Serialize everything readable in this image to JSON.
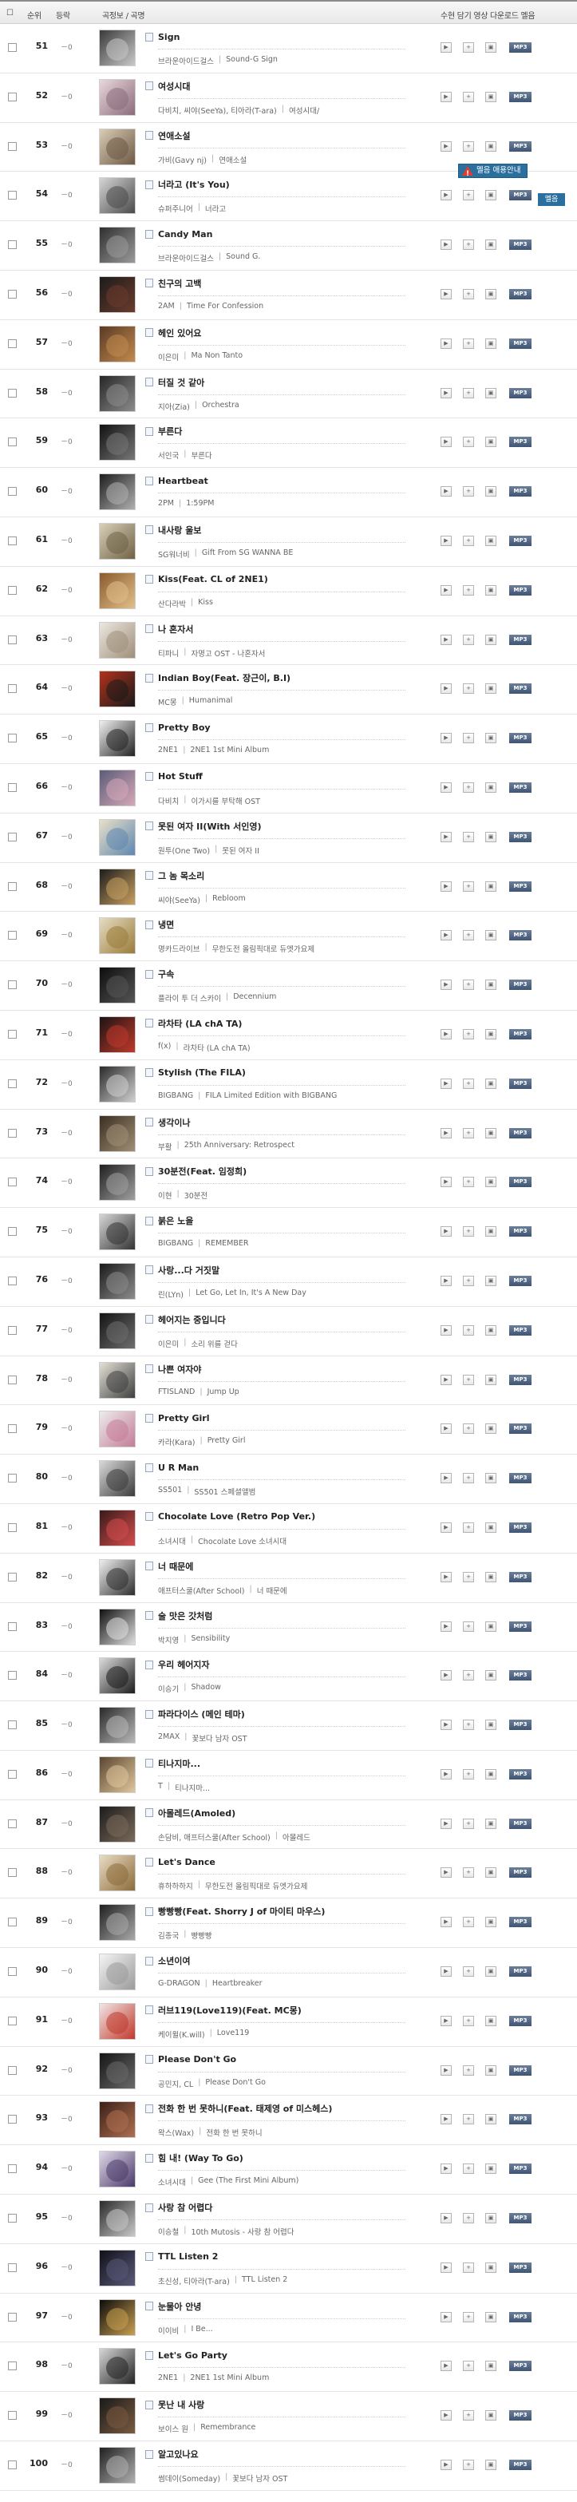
{
  "header": {
    "col_rank": "순위",
    "col_change": "등락",
    "col_song": "곡정보 / 곡명",
    "col_actions": "수현 담기 영상 다운로드 멜음"
  },
  "labels": {
    "change": "－0",
    "mp3": "MP3",
    "tooltip_main": "멜음 애용안내",
    "tooltip_side": "멜음"
  },
  "rows": [
    {
      "rank": "51",
      "title": "Sign",
      "artist": "브라운아이드걸스",
      "album": "Sound-G Sign",
      "c1": "#3a3a3a",
      "c2": "#c9c9c9"
    },
    {
      "rank": "52",
      "title": "여성시대",
      "artist": "다비치, 씨야(SeeYa), 티아라(T-ara)",
      "album": "여성시대/",
      "c1": "#e9d7dc",
      "c2": "#8b6b7b"
    },
    {
      "rank": "53",
      "title": "연애소설",
      "artist": "가비(Gavy nj)",
      "album": "연애소설",
      "c1": "#d9cbb5",
      "c2": "#6e5a44"
    },
    {
      "rank": "54",
      "title": "너라고 (It's You)",
      "artist": "슈퍼주니어",
      "album": "너라고",
      "c1": "#d5d5d5",
      "c2": "#4a4a4a"
    },
    {
      "rank": "55",
      "title": "Candy Man",
      "artist": "브라운아이드걸스",
      "album": "Sound G.",
      "c1": "#2f2f2f",
      "c2": "#9a9a9a"
    },
    {
      "rank": "56",
      "title": "친구의 고백",
      "artist": "2AM",
      "album": "Time For Confession",
      "c1": "#1c1c1c",
      "c2": "#6b3b2b"
    },
    {
      "rank": "57",
      "title": "헤인 있어요",
      "artist": "이은미",
      "album": "Ma Non Tanto",
      "c1": "#5a3a24",
      "c2": "#c28a4e"
    },
    {
      "rank": "58",
      "title": "터질 것 같아",
      "artist": "지아(Zia)",
      "album": "Orchestra",
      "c1": "#262626",
      "c2": "#8c8c8c"
    },
    {
      "rank": "59",
      "title": "부른다",
      "artist": "서인국",
      "album": "부른다",
      "c1": "#111111",
      "c2": "#777777"
    },
    {
      "rank": "60",
      "title": "Heartbeat",
      "artist": "2PM",
      "album": "1:59PM",
      "c1": "#1e1e1e",
      "c2": "#b0b0b0"
    },
    {
      "rank": "61",
      "title": "내사랑 울보",
      "artist": "SG워너비",
      "album": "Gift From SG WANNA BE",
      "c1": "#d8cfb8",
      "c2": "#6f6246"
    },
    {
      "rank": "62",
      "title": "Kiss(Feat. CL of 2NE1)",
      "artist": "산다라박",
      "album": "Kiss",
      "c1": "#8a5a2e",
      "c2": "#e2c08a"
    },
    {
      "rank": "63",
      "title": "나 혼자서",
      "artist": "티파니",
      "album": "자명고 OST - 나혼자서",
      "c1": "#ece7e0",
      "c2": "#9f8f7a"
    },
    {
      "rank": "64",
      "title": "Indian Boy(Feat. 장근이, B.I)",
      "artist": "MC몽",
      "album": "Humanimal",
      "c1": "#b4321c",
      "c2": "#1a1a1a"
    },
    {
      "rank": "65",
      "title": "Pretty Boy",
      "artist": "2NE1",
      "album": "2NE1 1st Mini Album",
      "c1": "#f0f0f0",
      "c2": "#222222"
    },
    {
      "rank": "66",
      "title": "Hot Stuff",
      "artist": "다비치",
      "album": "이가시를 부탁해 OST",
      "c1": "#5c5c78",
      "c2": "#d6a8b8"
    },
    {
      "rank": "67",
      "title": "못된 여자 II(With 서인영)",
      "artist": "원투(One Two)",
      "album": "못된 여자 II",
      "c1": "#e8e0c8",
      "c2": "#5e87b0"
    },
    {
      "rank": "68",
      "title": "그 놈 목소리",
      "artist": "씨야(SeeYa)",
      "album": "Rebloom",
      "c1": "#1d1d1d",
      "c2": "#c9a060"
    },
    {
      "rank": "69",
      "title": "냉면",
      "artist": "명카드라이브",
      "album": "무한도전 올림픽대로 듀엣가요제",
      "c1": "#e6dcc2",
      "c2": "#9a7b3a"
    },
    {
      "rank": "70",
      "title": "구속",
      "artist": "플라이 투 더 스카이",
      "album": "Decennium",
      "c1": "#0d0d0d",
      "c2": "#555555"
    },
    {
      "rank": "71",
      "title": "라차타 (LA chA TA)",
      "artist": "f(x)",
      "album": "라차타 (LA chA TA)",
      "c1": "#1b1414",
      "c2": "#c0392b"
    },
    {
      "rank": "72",
      "title": "Stylish (The FILA)",
      "artist": "BIGBANG",
      "album": "FILA Limited Edition with BIGBANG",
      "c1": "#2a2a2a",
      "c2": "#d0d0d0"
    },
    {
      "rank": "73",
      "title": "생각이나",
      "artist": "부활",
      "album": "25th Anniversary: Retrospect",
      "c1": "#3b2e22",
      "c2": "#a08f74"
    },
    {
      "rank": "74",
      "title": "30분전(Feat. 임정희)",
      "artist": "이현",
      "album": "30분전",
      "c1": "#1f1f1f",
      "c2": "#a0a0a0"
    },
    {
      "rank": "75",
      "title": "붉은 노을",
      "artist": "BIGBANG",
      "album": "REMEMBER",
      "c1": "#d6d6d6",
      "c2": "#333333"
    },
    {
      "rank": "76",
      "title": "사랑...다 거짓말",
      "artist": "린(LYn)",
      "album": "Let Go, Let In, It's A New Day",
      "c1": "#1a1a1a",
      "c2": "#8d8d8d"
    },
    {
      "rank": "77",
      "title": "헤어지는 중입니다",
      "artist": "이은미",
      "album": "소리 위를 걷다",
      "c1": "#141414",
      "c2": "#6e6e6e"
    },
    {
      "rank": "78",
      "title": "나쁜 여자야",
      "artist": "FTISLAND",
      "album": "Jump Up",
      "c1": "#e4e0d6",
      "c2": "#3f3f3f"
    },
    {
      "rank": "79",
      "title": "Pretty Girl",
      "artist": "카라(Kara)",
      "album": "Pretty Girl",
      "c1": "#ececec",
      "c2": "#c47c98"
    },
    {
      "rank": "80",
      "title": "U R Man",
      "artist": "SS501",
      "album": "SS501 스페셜앨범",
      "c1": "#d9d9d9",
      "c2": "#3b3b3b"
    },
    {
      "rank": "81",
      "title": "Chocolate Love (Retro Pop Ver.)",
      "artist": "소녀시대",
      "album": "Chocolate Love 소녀시대",
      "c1": "#3a1a1a",
      "c2": "#d44d4d"
    },
    {
      "rank": "82",
      "title": "너 때문에",
      "artist": "애프터스쿨(After School)",
      "album": "너 때문에",
      "c1": "#efefef",
      "c2": "#2d2d2d"
    },
    {
      "rank": "83",
      "title": "술 맛은 갓처럼",
      "artist": "박지영",
      "album": "Sensibility",
      "c1": "#101010",
      "c2": "#e0e0e0"
    },
    {
      "rank": "84",
      "title": "우리 헤어지자",
      "artist": "이승기",
      "album": "Shadow",
      "c1": "#dcdcdc",
      "c2": "#1c1c1c"
    },
    {
      "rank": "85",
      "title": "파라다이스 (메인 테마)",
      "artist": "2MAX",
      "album": "꽃보다 남자 OST",
      "c1": "#2a2a2a",
      "c2": "#b8b8b8"
    },
    {
      "rank": "86",
      "title": "티나지마...",
      "artist": "T",
      "album": "티나지마...",
      "c1": "#5a4630",
      "c2": "#e1c79c"
    },
    {
      "rank": "87",
      "title": "아몰레드(Amoled)",
      "artist": "손담비, 애프터스쿨(After School)",
      "album": "아몰레드",
      "c1": "#1c1c1c",
      "c2": "#7a6a5a"
    },
    {
      "rank": "88",
      "title": "Let's Dance",
      "artist": "휴하하하지",
      "album": "무한도전 올림픽대로 듀엣가요제",
      "c1": "#e8dcc4",
      "c2": "#8c6b3a"
    },
    {
      "rank": "89",
      "title": "빵빵빵(Feat. Shorry J of 마이티 마우스)",
      "artist": "김종국",
      "album": "빵빵빵",
      "c1": "#202020",
      "c2": "#a9a9a9"
    },
    {
      "rank": "90",
      "title": "소년이여",
      "artist": "G-DRAGON",
      "album": "Heartbreaker",
      "c1": "#f4f4f4",
      "c2": "#9a9a9a"
    },
    {
      "rank": "91",
      "title": "러브119(Love119)(Feat. MC몽)",
      "artist": "케이윌(K.will)",
      "album": "Love119",
      "c1": "#f2e6e6",
      "c2": "#c0392b"
    },
    {
      "rank": "92",
      "title": "Please Don't Go",
      "artist": "공민지, CL",
      "album": "Please Don't Go",
      "c1": "#151515",
      "c2": "#6a6a6a"
    },
    {
      "rank": "93",
      "title": "전화 한 번 못하니(Feat. 태제영 of 미스헤스)",
      "artist": "왁스(Wax)",
      "album": "전화 한 번 못하니",
      "c1": "#3a2018",
      "c2": "#b07050"
    },
    {
      "rank": "94",
      "title": "힘 내! (Way To Go)",
      "artist": "소녀시대",
      "album": "Gee (The First Mini Album)",
      "c1": "#e0d8e8",
      "c2": "#4a3a6a"
    },
    {
      "rank": "95",
      "title": "사랑 참 어렵다",
      "artist": "이승철",
      "album": "10th Mutosis - 사랑 참 어렵다",
      "c1": "#2a2a2a",
      "c2": "#c8c8c8"
    },
    {
      "rank": "96",
      "title": "TTL Listen 2",
      "artist": "초신성, 티아라(T-ara)",
      "album": "TTL Listen 2",
      "c1": "#101018",
      "c2": "#5a5a7a"
    },
    {
      "rank": "97",
      "title": "눈물아 안녕",
      "artist": "이이비",
      "album": "I Be...",
      "c1": "#0c0c0c",
      "c2": "#c9a050"
    },
    {
      "rank": "98",
      "title": "Let's Go Party",
      "artist": "2NE1",
      "album": "2NE1 1st Mini Album",
      "c1": "#d6d6d6",
      "c2": "#242424"
    },
    {
      "rank": "99",
      "title": "못난 내 사랑",
      "artist": "보이스 원",
      "album": "Remembrance",
      "c1": "#1a1a1a",
      "c2": "#7a5a40"
    },
    {
      "rank": "100",
      "title": "알고있나요",
      "artist": "썸데이(Someday)",
      "album": "꽃보다 남자 OST",
      "c1": "#202020",
      "c2": "#b0b0b0"
    }
  ]
}
